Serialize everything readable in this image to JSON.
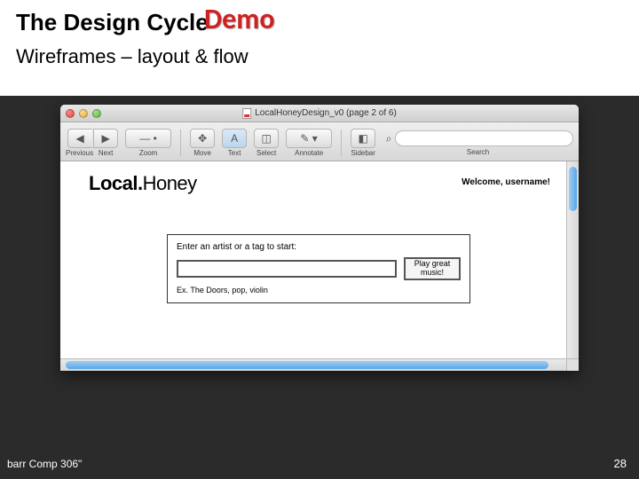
{
  "slide": {
    "title": "The Design Cycle",
    "subtitle": "Wireframes – layout & flow",
    "footer_left": "barr Comp 306\"",
    "page_number": "28"
  },
  "overlay": {
    "demo_label": "Demo"
  },
  "window": {
    "title": "LocalHoneyDesign_v0 (page 2 of 6)",
    "toolbar": {
      "previous": "Previous",
      "next": "Next",
      "zoom": "Zoom",
      "move": "Move",
      "text": "Text",
      "select": "Select",
      "annotate": "Annotate",
      "sidebar": "Sidebar",
      "search": "Search"
    }
  },
  "wireframe": {
    "logo_a": "Local.",
    "logo_b": "Honey",
    "welcome": "Welcome, username!",
    "prompt": "Enter an artist or a tag to start:",
    "button": "Play great music!",
    "hint": "Ex. The Doors, pop, violin"
  }
}
